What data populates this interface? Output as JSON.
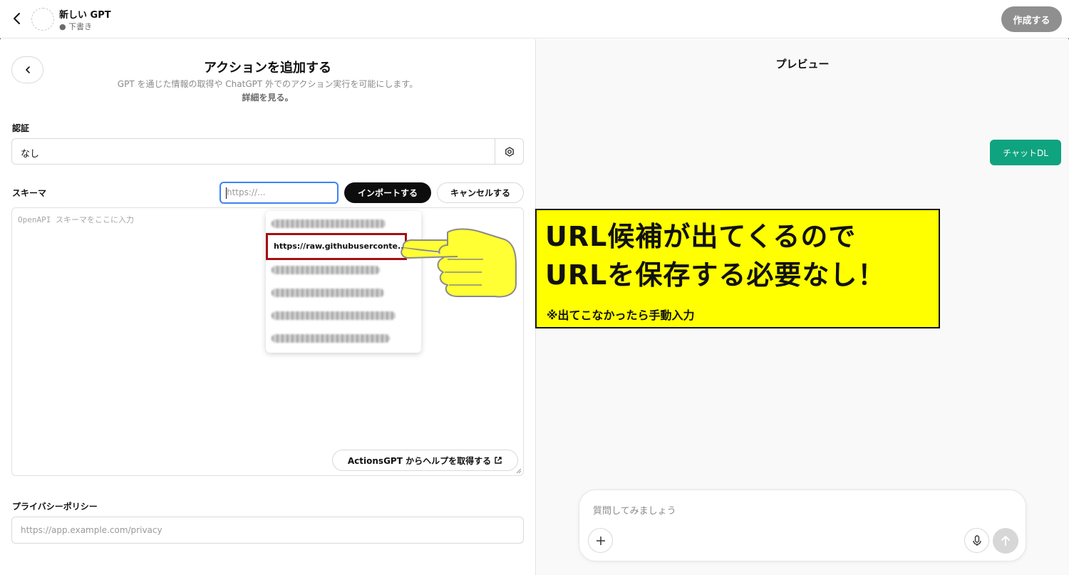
{
  "header": {
    "gpt_name": "新しい GPT",
    "gpt_status": "● 下書き",
    "create_label": "作成する"
  },
  "left_panel": {
    "title": "アクションを追加する",
    "subtitle": "GPT を通じた情報の取得や ChatGPT 外でのアクション実行を可能にします。",
    "learn_more": "詳細を見る。",
    "auth": {
      "label": "認証",
      "value": "なし"
    },
    "schema": {
      "label": "スキーマ",
      "url_placeholder": "https://...",
      "import_label": "インポートする",
      "cancel_label": "キャンセルする",
      "editor_placeholder": "OpenAPI スキーマをここに入力",
      "help_label": "ActionsGPT からヘルプを取得する",
      "suggestion": "https://raw.githubuserconte..."
    },
    "privacy": {
      "label": "プライバシーポリシー",
      "placeholder": "https://app.example.com/privacy"
    }
  },
  "preview": {
    "title": "プレビュー",
    "chat_dl_label": "チャットDL",
    "composer_placeholder": "質問してみましょう"
  },
  "annotation": {
    "line1": "URL候補が出てくるので",
    "line2": "URLを保存する必要なし！",
    "note": "※出てこなかったら手動入力"
  },
  "colors": {
    "accent_green": "#10a37f",
    "callout_yellow": "#ffff00",
    "highlight_red": "#a30f14",
    "input_focus_blue": "#3b82f6"
  }
}
